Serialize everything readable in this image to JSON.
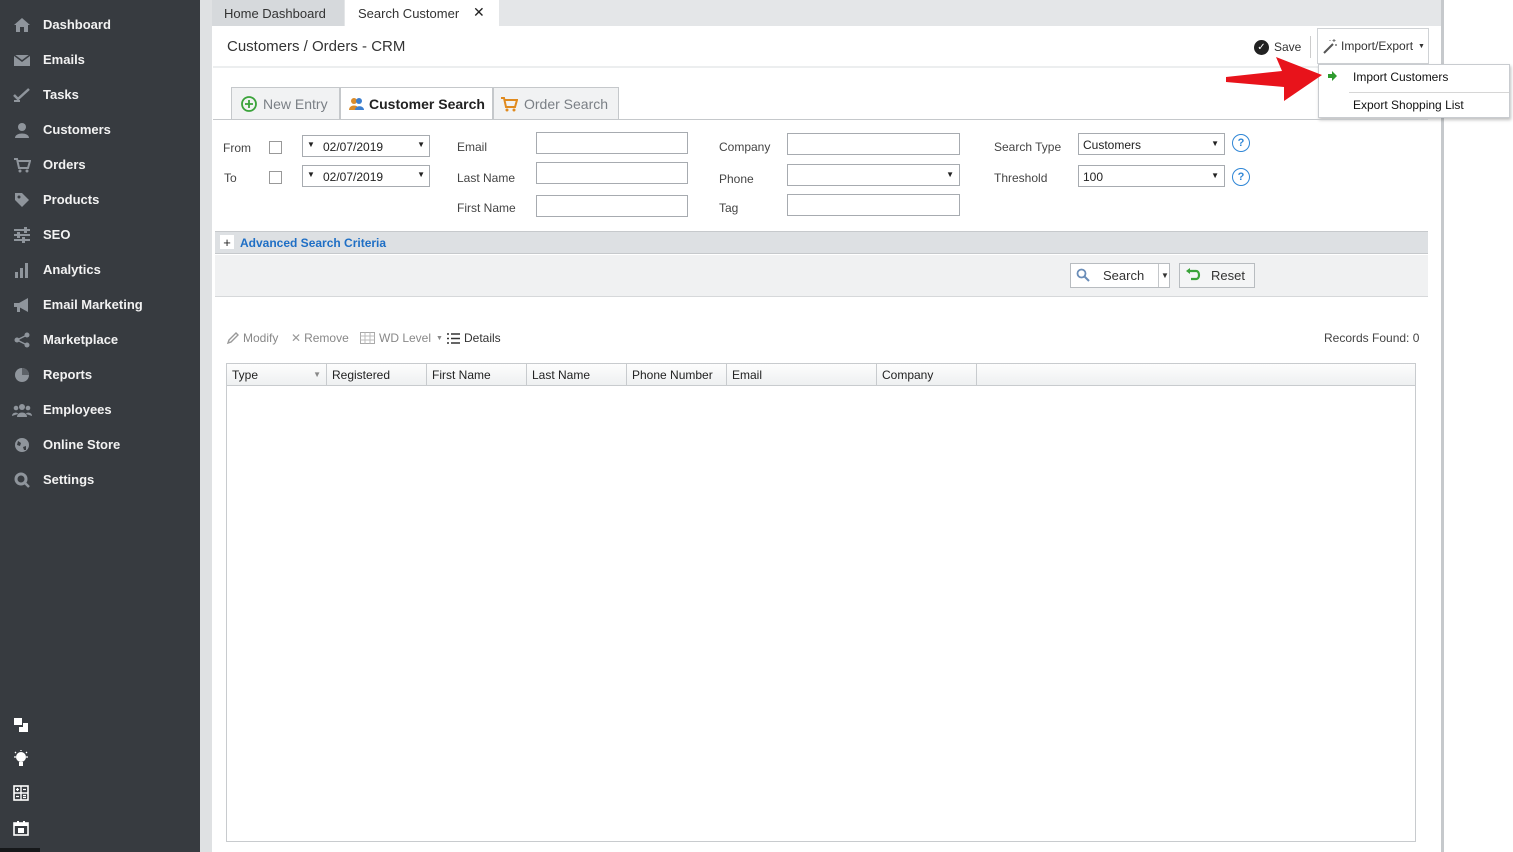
{
  "sidebar": {
    "items": [
      {
        "label": "Dashboard",
        "icon": "home-icon"
      },
      {
        "label": "Emails",
        "icon": "envelope-icon"
      },
      {
        "label": "Tasks",
        "icon": "tasks-icon"
      },
      {
        "label": "Customers",
        "icon": "user-icon"
      },
      {
        "label": "Orders",
        "icon": "cart-icon"
      },
      {
        "label": "Products",
        "icon": "tag-icon"
      },
      {
        "label": "SEO",
        "icon": "sliders-icon"
      },
      {
        "label": "Analytics",
        "icon": "bar-chart-icon"
      },
      {
        "label": "Email Marketing",
        "icon": "megaphone-icon"
      },
      {
        "label": "Marketplace",
        "icon": "share-icon"
      },
      {
        "label": "Reports",
        "icon": "pie-chart-icon"
      },
      {
        "label": "Employees",
        "icon": "group-icon"
      },
      {
        "label": "Online Store",
        "icon": "globe-icon"
      },
      {
        "label": "Settings",
        "icon": "gear-search-icon"
      }
    ],
    "bottom_icons": [
      "layout-icon",
      "lightbulb-icon",
      "calculator-icon",
      "calendar-icon"
    ]
  },
  "tabs": {
    "home": "Home Dashboard",
    "search": "Search Customer"
  },
  "header": {
    "title": "Customers / Orders - CRM",
    "save_label": "Save",
    "impexp_label": "Import/Export"
  },
  "dropdown": {
    "items": [
      "Import Customers",
      "Export Shopping List"
    ]
  },
  "subtabs": {
    "new_entry": "New Entry",
    "customer_search": "Customer Search",
    "order_search": "Order Search"
  },
  "form": {
    "from_label": "From",
    "to_label": "To",
    "from_date": "02/07/2019",
    "to_date": "02/07/2019",
    "email_label": "Email",
    "last_name_label": "Last Name",
    "first_name_label": "First Name",
    "company_label": "Company",
    "phone_label": "Phone",
    "tag_label": "Tag",
    "search_type_label": "Search Type",
    "search_type_value": "Customers",
    "threshold_label": "Threshold",
    "threshold_value": "100",
    "help_glyph": "?"
  },
  "advanced": {
    "toggle": "+",
    "label": "Advanced Search Criteria"
  },
  "buttons": {
    "search": "Search",
    "reset": "Reset"
  },
  "toolbar": {
    "modify": "Modify",
    "remove": "Remove",
    "wd_level": "WD Level",
    "details": "Details",
    "records": "Records Found: 0"
  },
  "grid": {
    "columns": [
      "Type",
      "Registered",
      "First Name",
      "Last Name",
      "Phone Number",
      "Email",
      "Company"
    ]
  },
  "colors": {
    "sidebar_bg": "#373b40",
    "link": "#1f6fc5",
    "annotation_arrow": "#e8131b"
  }
}
